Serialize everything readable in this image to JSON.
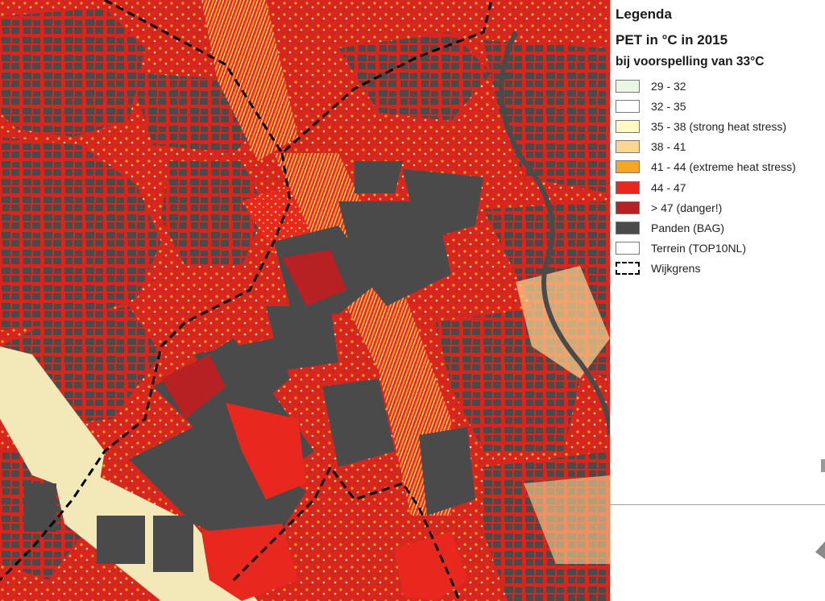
{
  "legend": {
    "title": "Legenda",
    "subtitle": "PET in °C in 2015",
    "subtitle2": "bij voorspelling van 33°C",
    "items": [
      {
        "label": "29 - 32",
        "color": "#eaf7e4"
      },
      {
        "label": "32 - 35",
        "color": "#ffffff"
      },
      {
        "label": "35 - 38 (strong heat stress)",
        "color": "#fff8c2"
      },
      {
        "label": "38 - 41",
        "color": "#fdd692"
      },
      {
        "label": "41 - 44 (extreme heat stress)",
        "color": "#f5a623"
      },
      {
        "label": "44 - 47",
        "color": "#e8281e"
      },
      {
        "label": "> 47 (danger!)",
        "color": "#b82124"
      },
      {
        "label": "Panden (BAG)",
        "color": "#4a4a4a"
      },
      {
        "label": "Terrein (TOP10NL)",
        "color": "#ffffff"
      },
      {
        "label": "Wijkgrens",
        "color": "#000000"
      }
    ]
  },
  "colors": {
    "street_red": "#d7261e",
    "building": "#4a4a4a",
    "hot_red": "#e8281e",
    "danger_red": "#b82124",
    "orange": "#f5a623",
    "light_orange": "#fdd692",
    "cream": "#f2e8b8",
    "boundary": "#000000"
  }
}
